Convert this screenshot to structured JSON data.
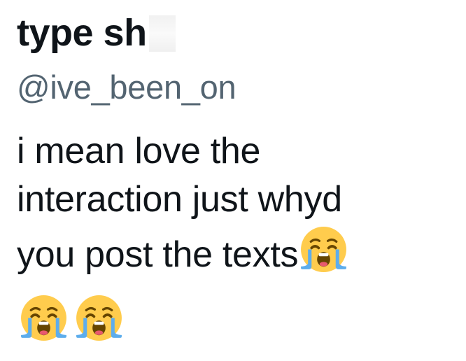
{
  "tweet": {
    "display_name": "type sh",
    "handle": "@ive_been_on",
    "text_lines": [
      "i mean love the",
      "interaction just whyd",
      "you post the texts"
    ],
    "emojis": [
      "loudly-crying-face-icon",
      "loudly-crying-face-icon",
      "loudly-crying-face-icon"
    ]
  },
  "colors": {
    "text": "#0f1419",
    "handle": "#536471",
    "emoji_face": "#ffcc4d",
    "emoji_tears": "#5dadec"
  }
}
